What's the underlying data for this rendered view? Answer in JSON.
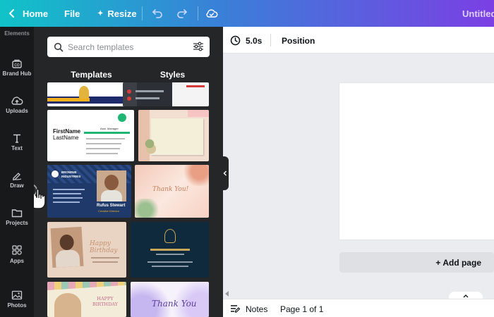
{
  "topbar": {
    "home_label": "Home",
    "file_label": "File",
    "resize_label": "Resize",
    "title": "Untitled"
  },
  "rail": {
    "items": [
      {
        "label": "Elements",
        "icon": "elements-icon"
      },
      {
        "label": "Brand Hub",
        "icon": "brand-hub-icon"
      },
      {
        "label": "Uploads",
        "icon": "cloud-upload-icon"
      },
      {
        "label": "Text",
        "icon": "text-icon"
      },
      {
        "label": "Draw",
        "icon": "pen-icon"
      },
      {
        "label": "Projects",
        "icon": "folder-icon"
      },
      {
        "label": "Apps",
        "icon": "apps-grid-icon"
      },
      {
        "label": "Photos",
        "icon": "image-icon"
      }
    ]
  },
  "panel": {
    "search_placeholder": "Search templates",
    "tabs": [
      "Templates",
      "Styles"
    ],
    "cards": {
      "firstname": "FirstName",
      "lastname": "LastName",
      "role": "Asst. Manager",
      "person_name": "Rufus Stewart",
      "person_title": "Creative Director",
      "company": "BROWNIE INDUSTRIES",
      "thank_you": "Thank You!",
      "happy_birthday": "Happy Birthday",
      "happy_birthday_2": "HAPPY BIRTHDAY",
      "thank_you_2": "Thank You"
    }
  },
  "toolbar": {
    "duration": "5.0s",
    "position_label": "Position"
  },
  "canvas": {
    "add_page_label": "+ Add page"
  },
  "bottombar": {
    "notes_label": "Notes",
    "page_label": "Page 1 of 1"
  },
  "colors": {
    "accent": "#8b3dff",
    "rail_bg": "#18191b",
    "panel_bg": "#252627"
  }
}
